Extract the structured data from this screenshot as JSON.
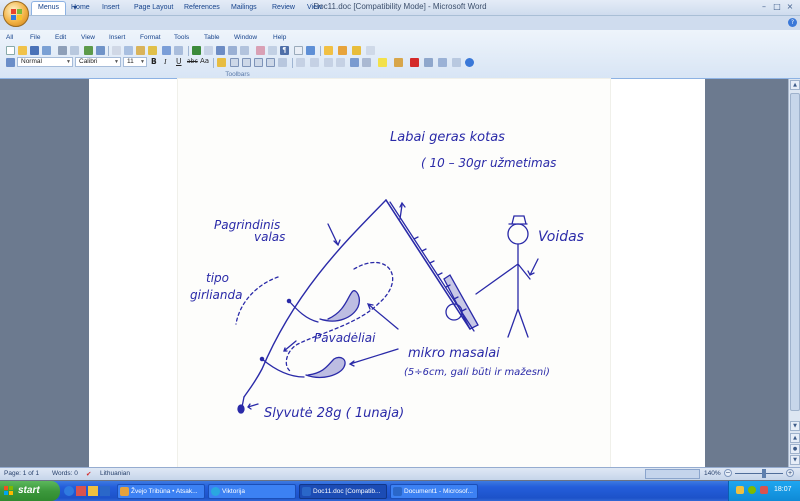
{
  "window": {
    "title": "Doc11.doc [Compatibility Mode] - Microsoft Word",
    "controls": {
      "minimize": "–",
      "maximize": "□",
      "close": "×"
    }
  },
  "quick_access": {
    "undo": "↶",
    "redo": "↷",
    "customize": "▾"
  },
  "tabs": [
    "Menus",
    "Home",
    "Insert",
    "Page Layout",
    "References",
    "Mailings",
    "Review",
    "View"
  ],
  "menus": [
    "All",
    "File",
    "Edit",
    "View",
    "Insert",
    "Format",
    "Tools",
    "Table",
    "Window",
    "Help"
  ],
  "formatting": {
    "style": "Normal",
    "font": "Calibri",
    "size": "11",
    "bold": "B",
    "italic": "I",
    "underline": "U",
    "abc": "abc",
    "aa": "Aa"
  },
  "toolbars_label": "Toolbars",
  "sketch": {
    "labai_geras": "Labai geras kotas",
    "uzmetimas": "( 10 – 30gr užmetimas",
    "pagrindinis_1": "Pagrindinis",
    "pagrindinis_2": "valas",
    "voidas": "Voidas",
    "tipo": "tipo",
    "girlianda": "girlianda",
    "pavadeliai": "Pavadėliai",
    "mikro": "mikro masalai",
    "mikro_sub": "(5÷6cm, gali būti ir mažesni)",
    "slyvute": "Slyvutė   28g ( 1unaja)"
  },
  "status": {
    "page": "Page: 1 of 1",
    "words": "Words: 0",
    "language": "Lithuanian",
    "zoom": "140%"
  },
  "taskbar": {
    "start": "start",
    "tasks": [
      "Žvejo Tribūna • Atsak...",
      "Viktorija",
      "Doc11.doc [Compatib...",
      "Document1 - Microsof..."
    ],
    "clock": "18:07"
  },
  "colors": {
    "ribbon": "#d8e5f5",
    "ink": "#2a2aa8",
    "taskbar": "#245edb",
    "start": "#3c983c"
  }
}
